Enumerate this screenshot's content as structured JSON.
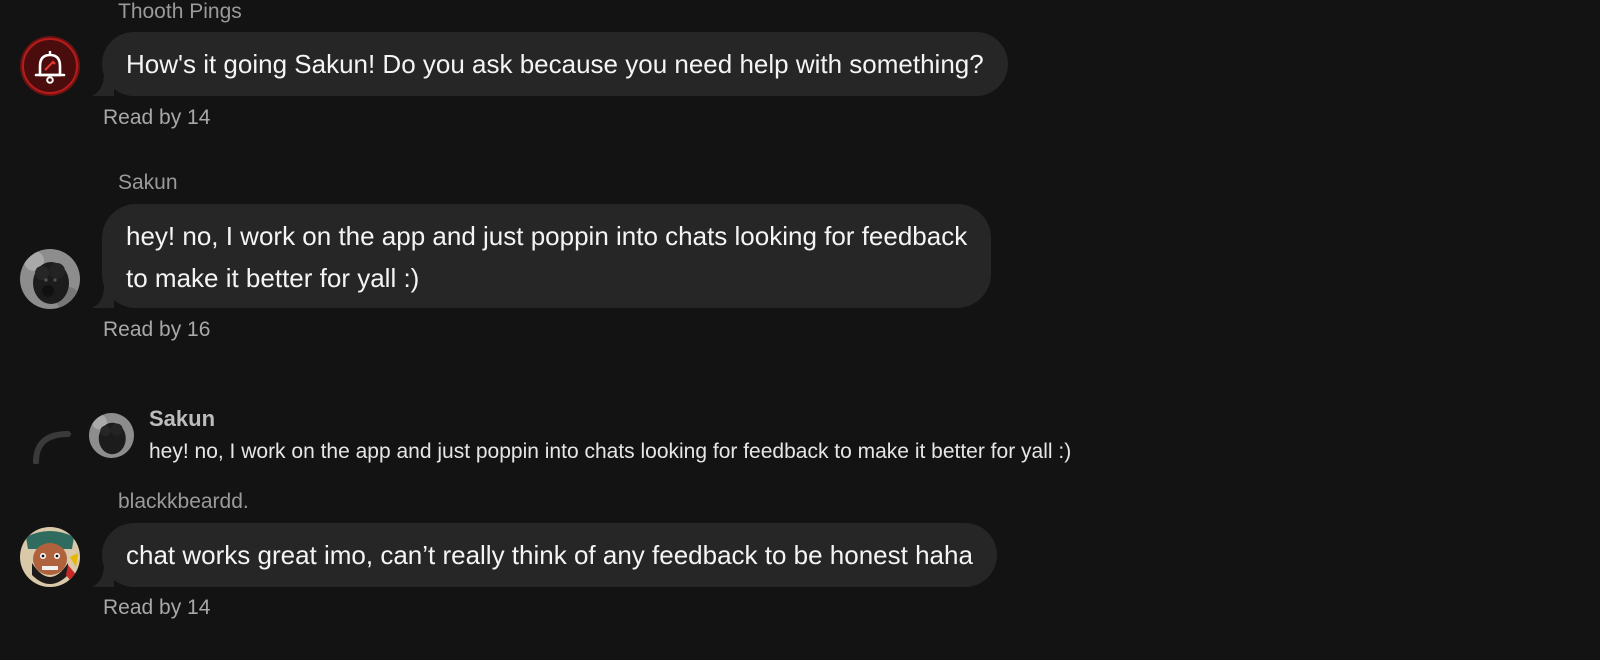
{
  "messages": [
    {
      "sender": "Thooth Pings",
      "avatar": "notification-bell-icon",
      "lines": [
        "How's it going Sakun! Do you ask because you need help with something?"
      ],
      "read_receipt": "Read by 14"
    },
    {
      "sender": "Sakun",
      "avatar": "dog-photo-avatar",
      "lines": [
        "hey! no, I work on the app and just poppin into chats looking for feedback",
        "to make it better for yall :)"
      ],
      "read_receipt": "Read by 16"
    },
    {
      "reply_to": {
        "name": "Sakun",
        "text": "hey! no, I work on the app and just poppin into chats looking for feedback to make it better for yall :)"
      },
      "sender": "blackkbeardd.",
      "avatar": "pirate-cartoon-avatar",
      "lines": [
        "chat works great imo, can’t really think of any feedback to be honest haha"
      ],
      "read_receipt": "Read by 14"
    }
  ],
  "colors": {
    "background": "#131313",
    "bubble": "#262626",
    "bell_avatar_bg": "#5a0f0f",
    "bell_avatar_ring": "#c62828"
  }
}
